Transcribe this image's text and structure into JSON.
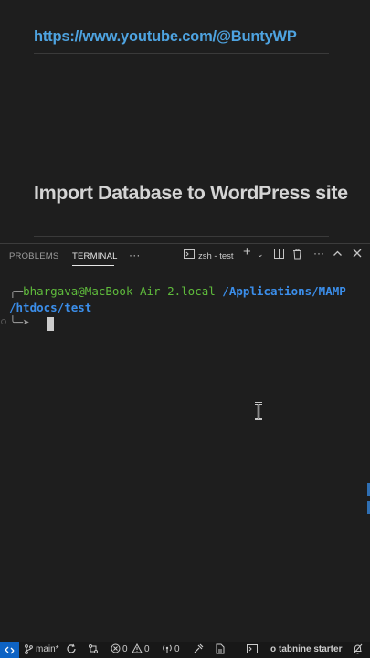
{
  "editor": {
    "link_text": "https://www.youtube.com/@BuntyWP",
    "heading": "Import Database to WordPress site"
  },
  "panel": {
    "tabs": [
      {
        "label": "PROBLEMS",
        "active": false
      },
      {
        "label": "TERMINAL",
        "active": true
      }
    ],
    "more_label": "···",
    "terminal_instance": "zsh - test",
    "icons": [
      "terminal-icon",
      "plus-icon",
      "chevron-down-icon",
      "split-icon",
      "trash-icon",
      "ellipsis-icon",
      "chevron-up-icon",
      "close-icon"
    ]
  },
  "terminal": {
    "prompt_corner": "╭─",
    "user_host": "bhargava@MacBook-Air-2.local",
    "path_part1": " /Applications/MAMP",
    "path_part2": "/htdocs/test",
    "prompt_arrow": "╰─➤"
  },
  "statusbar": {
    "branch": "main*",
    "errors": "0",
    "warnings": "0",
    "info": "0",
    "tabnine": "tabnine starter",
    "accent_color": "#0e63c4"
  }
}
